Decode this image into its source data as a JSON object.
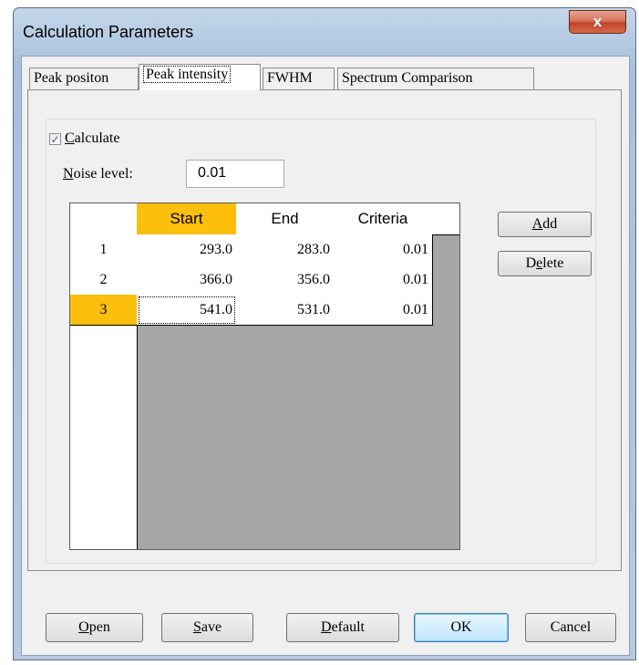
{
  "window": {
    "title": "Calculation Parameters",
    "close_glyph": "x"
  },
  "tabs": [
    {
      "label": "Peak positon",
      "selected": false
    },
    {
      "label": "Peak intensity",
      "selected": true
    },
    {
      "label": "FWHM",
      "selected": false
    },
    {
      "label": "Spectrum Comparison",
      "selected": false
    }
  ],
  "calculate": {
    "label": "Calculate",
    "checked": true,
    "mnemonic": "C"
  },
  "noise": {
    "label": "Noise level:",
    "value": "0.01"
  },
  "grid": {
    "columns": [
      "Start",
      "End",
      "Criteria"
    ],
    "rows": [
      {
        "index": "1",
        "start": "293.0",
        "end": "283.0",
        "criteria": "0.01"
      },
      {
        "index": "2",
        "start": "366.0",
        "end": "356.0",
        "criteria": "0.01"
      },
      {
        "index": "3",
        "start": "541.0",
        "end": "531.0",
        "criteria": "0.01"
      }
    ],
    "highlight_color": "#fcbf0b"
  },
  "side_buttons": {
    "add": "Add",
    "delete": "Delete"
  },
  "buttons": {
    "open": "Open",
    "save": "Save",
    "default": "Default",
    "ok": "OK",
    "cancel": "Cancel"
  },
  "icons": {
    "checkbox": "checkmark-icon",
    "close": "close-icon"
  }
}
